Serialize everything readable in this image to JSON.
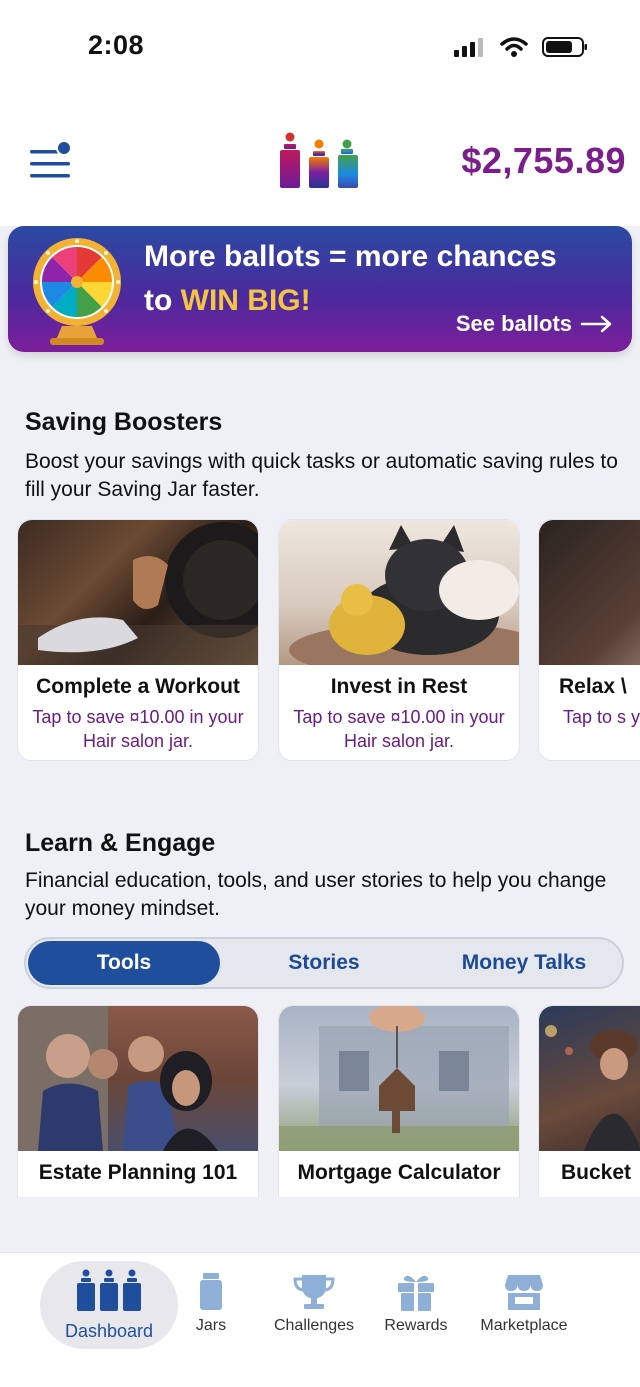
{
  "status_bar": {
    "time": "2:08"
  },
  "header": {
    "balance": "$2,755.89"
  },
  "banner": {
    "line1": "More ballots = more chances",
    "line2_prefix": "to ",
    "line2_highlight": "WIN BIG!",
    "cta": "See ballots"
  },
  "saving_boosters": {
    "title": "Saving Boosters",
    "description": "Boost your savings with quick tasks or automatic saving rules to fill your Saving Jar faster.",
    "cards": [
      {
        "title": "Complete a Workout",
        "subtitle": "Tap to save ¤10.00 in your Hair salon  jar."
      },
      {
        "title": "Invest in Rest",
        "subtitle": "Tap to save ¤10.00 in your Hair salon  jar."
      },
      {
        "title": "Relax \\",
        "subtitle": "Tap to s your"
      }
    ]
  },
  "learn_engage": {
    "title": "Learn & Engage",
    "description": "Financial education, tools, and user stories to help you change your money mindset.",
    "tabs": [
      {
        "label": "Tools",
        "active": true
      },
      {
        "label": "Stories",
        "active": false
      },
      {
        "label": "Money Talks",
        "active": false
      }
    ],
    "cards": [
      {
        "title": "Estate Planning 101"
      },
      {
        "title": "Mortgage Calculator"
      },
      {
        "title": "Bucket"
      }
    ]
  },
  "bottom_nav": {
    "items": [
      {
        "label": "Dashboard",
        "icon": "jars-trio-icon",
        "active": true
      },
      {
        "label": "Jars",
        "icon": "jar-icon",
        "active": false
      },
      {
        "label": "Challenges",
        "icon": "trophy-icon",
        "active": false
      },
      {
        "label": "Rewards",
        "icon": "gift-icon",
        "active": false
      },
      {
        "label": "Marketplace",
        "icon": "store-icon",
        "active": false
      }
    ]
  },
  "colors": {
    "brand_purple": "#7b1d8a",
    "brand_blue": "#1f4f9c",
    "win_yellow": "#f4c542"
  }
}
